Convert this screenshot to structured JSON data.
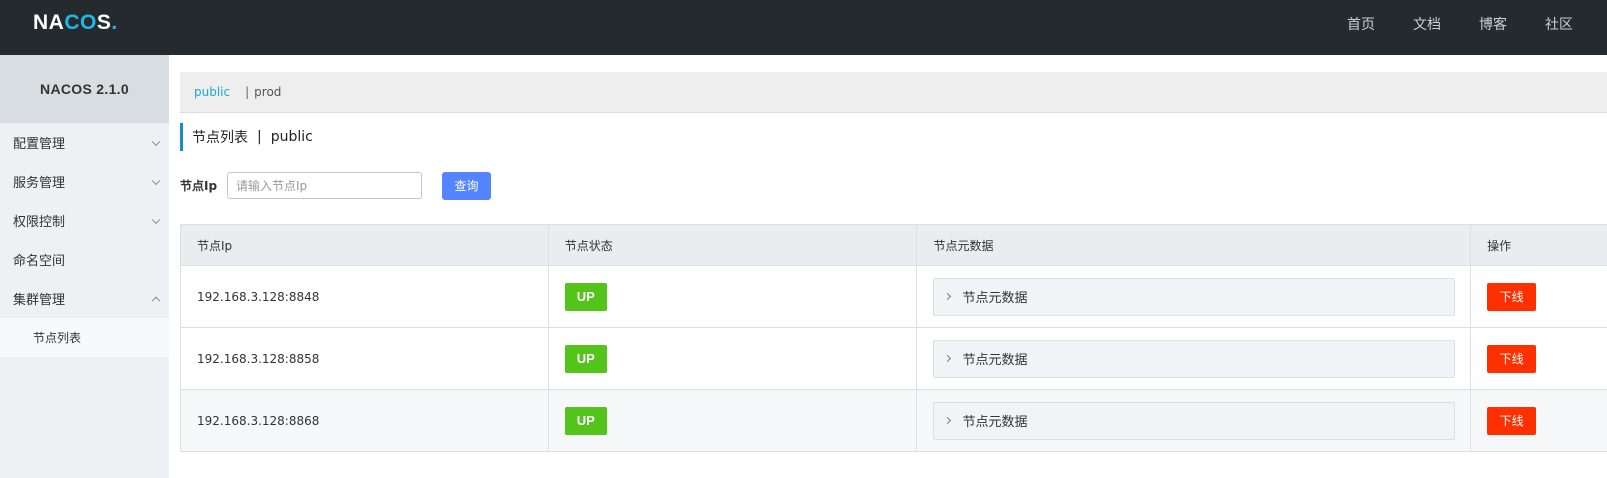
{
  "header": {
    "logo": {
      "prefix": "NA",
      "mid": "CO",
      "suffix": "S",
      "dot": "."
    },
    "nav": [
      "首页",
      "文档",
      "博客",
      "社区"
    ]
  },
  "sidebar": {
    "title": "NACOS 2.1.0",
    "items": [
      {
        "label": "配置管理",
        "expandable": true,
        "expanded": false
      },
      {
        "label": "服务管理",
        "expandable": true,
        "expanded": false
      },
      {
        "label": "权限控制",
        "expandable": true,
        "expanded": false
      },
      {
        "label": "命名空间",
        "expandable": false
      },
      {
        "label": "集群管理",
        "expandable": true,
        "expanded": true
      }
    ],
    "sub_items": [
      "节点列表"
    ]
  },
  "namespace_bar": {
    "active": "public",
    "separator": "|",
    "other": "prod"
  },
  "page": {
    "title": "节点列表",
    "separator": "|",
    "namespace": "public"
  },
  "search": {
    "label": "节点Ip",
    "placeholder": "请输入节点Ip",
    "value": "",
    "button": "查询"
  },
  "table": {
    "columns": [
      "节点Ip",
      "节点状态",
      "节点元数据",
      "操作"
    ],
    "rows": [
      {
        "ip": "192.168.3.128:8848",
        "status": "UP",
        "metadata": "节点元数据",
        "action": "下线"
      },
      {
        "ip": "192.168.3.128:8858",
        "status": "UP",
        "metadata": "节点元数据",
        "action": "下线"
      },
      {
        "ip": "192.168.3.128:8868",
        "status": "UP",
        "metadata": "节点元数据",
        "action": "下线"
      }
    ]
  },
  "colors": {
    "topbar": "#252a2f",
    "accent": "#1fb7e6",
    "primary_button": "#5584ff",
    "status_up": "#52c41a",
    "danger_button": "#ff3000"
  }
}
